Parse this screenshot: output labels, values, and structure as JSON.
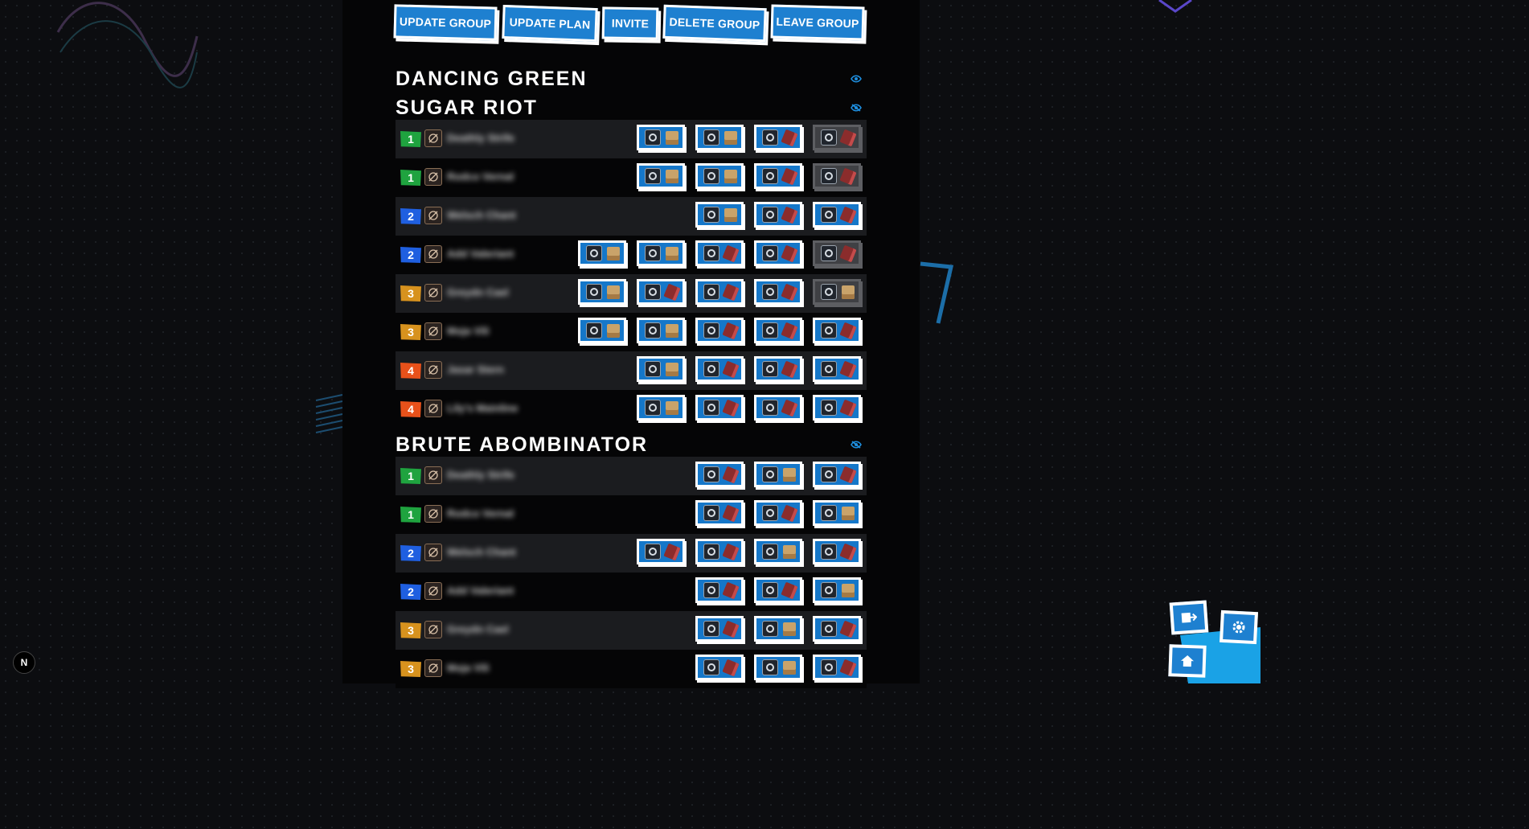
{
  "toolbar": {
    "buttons": [
      {
        "label": "UPDATE GROUP"
      },
      {
        "label": "UPDATE PLAN"
      },
      {
        "label": "INVITE"
      },
      {
        "label": "DELETE GROUP"
      },
      {
        "label": "LEAVE GROUP"
      }
    ]
  },
  "colors": {
    "accent": "#1e80d0",
    "party_1": "#1fa33f",
    "party_2": "#1f5fe0",
    "party_3": "#d7921e",
    "party_4": "#e8511a"
  },
  "sections": [
    {
      "title": "DANCING GREEN",
      "expanded": false,
      "toggle_icon": "eye-icon"
    },
    {
      "title": "SUGAR RIOT",
      "expanded": true,
      "toggle_icon": "eye-slash-icon"
    },
    {
      "title": "BRUTE ABOMBINATOR",
      "expanded": true,
      "toggle_icon": "eye-slash-icon"
    }
  ],
  "sugar_riot_rows": [
    {
      "party": "1",
      "job_icon": "paladin-icon",
      "name": "Deathly Strife",
      "slots": [
        {
          "gear": "earrings-icon",
          "src": "chest"
        },
        {
          "gear": "gloves-icon",
          "src": "chest"
        },
        {
          "gear": "ring-icon",
          "src": "tome"
        },
        {
          "gear": "bracelet-icon",
          "src": "tome",
          "done": true
        }
      ]
    },
    {
      "party": "1",
      "job_icon": "gunbreaker-icon",
      "name": "Rodco Vernal",
      "slots": [
        {
          "gear": "head-icon",
          "src": "chest"
        },
        {
          "gear": "gloves-icon",
          "src": "chest"
        },
        {
          "gear": "ring-icon",
          "src": "tome"
        },
        {
          "gear": "bracelet-icon",
          "src": "tome",
          "done": true
        }
      ]
    },
    {
      "party": "2",
      "job_icon": "bard-icon",
      "name": "Welsch Chant",
      "slots": [
        {
          "gear": "head-icon",
          "src": "chest"
        },
        {
          "gear": "necklace-icon",
          "src": "tome"
        },
        {
          "gear": "ring-icon",
          "src": "tome"
        }
      ]
    },
    {
      "party": "2",
      "job_icon": "machinist-icon",
      "name": "Add Valeriant",
      "slots": [
        {
          "gear": "head-icon",
          "src": "chest"
        },
        {
          "gear": "gloves-icon",
          "src": "chest"
        },
        {
          "gear": "ring-icon",
          "src": "tome"
        },
        {
          "gear": "feet-icon",
          "src": "tome"
        },
        {
          "gear": "bracelet-icon",
          "src": "tome",
          "done": true
        }
      ]
    },
    {
      "party": "3",
      "job_icon": "sage-icon",
      "name": "Greydn Cael",
      "slots": [
        {
          "gear": "head-icon",
          "src": "chest"
        },
        {
          "gear": "necklace-icon",
          "src": "tome"
        },
        {
          "gear": "feet-icon",
          "src": "tome"
        },
        {
          "gear": "ring-icon",
          "src": "tome"
        },
        {
          "gear": "earrings-icon",
          "src": "chest",
          "done": true
        }
      ]
    },
    {
      "party": "3",
      "job_icon": "pictomancer-icon",
      "name": "Moja Vili",
      "slots": [
        {
          "gear": "head-icon",
          "src": "chest"
        },
        {
          "gear": "earrings-icon",
          "src": "chest"
        },
        {
          "gear": "necklace-icon",
          "src": "tome"
        },
        {
          "gear": "feet-icon",
          "src": "tome"
        },
        {
          "gear": "ring-icon",
          "src": "tome"
        }
      ]
    },
    {
      "party": "4",
      "job_icon": "astrologian-icon",
      "name": "Jasar Stern",
      "slots": [
        {
          "gear": "gloves-icon",
          "src": "chest"
        },
        {
          "gear": "bracelet-icon",
          "src": "tome"
        },
        {
          "gear": "feet-icon",
          "src": "tome"
        },
        {
          "gear": "ring-icon",
          "src": "tome"
        }
      ]
    },
    {
      "party": "4",
      "job_icon": "conjurer-icon",
      "name": "Lily's Mainline",
      "slots": [
        {
          "gear": "gloves-icon",
          "src": "chest"
        },
        {
          "gear": "bracelet-icon",
          "src": "tome"
        },
        {
          "gear": "feet-icon",
          "src": "tome"
        },
        {
          "gear": "ring-icon",
          "src": "tome"
        }
      ]
    }
  ],
  "brute_rows": [
    {
      "party": "1",
      "job_icon": "paladin-icon",
      "name": "Deathly Strife",
      "slots": [
        {
          "gear": "head-icon",
          "src": "tome"
        },
        {
          "gear": "body-icon",
          "src": "chest"
        },
        {
          "gear": "legs-icon",
          "src": "tome"
        }
      ]
    },
    {
      "party": "1",
      "job_icon": "gunbreaker-icon",
      "name": "Rodco Vernal",
      "slots": [
        {
          "gear": "body-icon",
          "src": "tome"
        },
        {
          "gear": "earrings-icon",
          "src": "tome"
        },
        {
          "gear": "legs-icon",
          "src": "chest"
        }
      ]
    },
    {
      "party": "2",
      "job_icon": "bard-icon",
      "name": "Welsch Chant",
      "slots": [
        {
          "gear": "body-icon",
          "src": "tome"
        },
        {
          "gear": "earrings-icon",
          "src": "tome"
        },
        {
          "gear": "legs-icon",
          "src": "chest"
        },
        {
          "gear": "gloves-icon",
          "src": "tome"
        }
      ]
    },
    {
      "party": "2",
      "job_icon": "machinist-icon",
      "name": "Add Valeriant",
      "slots": [
        {
          "gear": "body-icon",
          "src": "tome"
        },
        {
          "gear": "earrings-icon",
          "src": "tome"
        },
        {
          "gear": "legs-icon",
          "src": "chest"
        }
      ]
    },
    {
      "party": "3",
      "job_icon": "sage-icon",
      "name": "Greydn Cael",
      "slots": [
        {
          "gear": "body-icon",
          "src": "tome"
        },
        {
          "gear": "legs-icon",
          "src": "chest"
        },
        {
          "gear": "gloves-icon",
          "src": "tome"
        }
      ]
    },
    {
      "party": "3",
      "job_icon": "pictomancer-icon",
      "name": "Moja Vili",
      "slots": [
        {
          "gear": "body-icon",
          "src": "tome"
        },
        {
          "gear": "legs-icon",
          "src": "chest"
        },
        {
          "gear": "gloves-icon",
          "src": "tome"
        }
      ]
    }
  ],
  "floating_nav": [
    {
      "icon": "logout-icon"
    },
    {
      "icon": "settings-icon"
    },
    {
      "icon": "home-icon"
    }
  ],
  "brand_badge": "N"
}
